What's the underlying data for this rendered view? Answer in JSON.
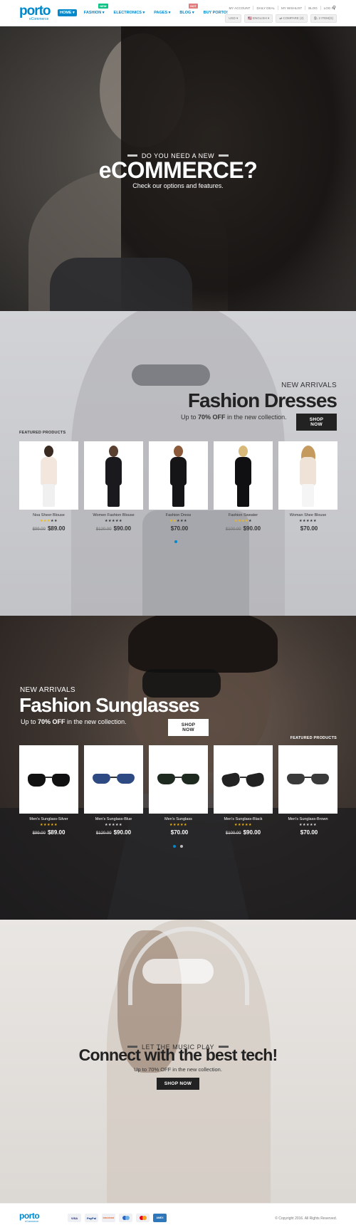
{
  "header": {
    "logo": "porto",
    "logo_sub": "eCommerce",
    "nav": [
      {
        "label": "HOME ▾",
        "active": true
      },
      {
        "label": "FASHION ▾",
        "badge": "NEW"
      },
      {
        "label": "ELECTRONICS ▾"
      },
      {
        "label": "PAGES ▾"
      },
      {
        "label": "BLOG ▾",
        "badge": "HOT"
      },
      {
        "label": "BUY PORTO!"
      }
    ],
    "top_links": [
      "MY ACCOUNT",
      "DAILY DEAL",
      "MY WISHLIST",
      "BLOG",
      "LOG IN"
    ],
    "currency": "USD ▾",
    "language": "🇺🇸 ENGLISH ▾",
    "compare": "⇄ COMPARE (2)",
    "cart": "🛍 2 ITEM(S)"
  },
  "hero1": {
    "kicker": "DO YOU NEED A NEW",
    "title": "eCOMMERCE?",
    "subtitle": "Check our options and features."
  },
  "dresses": {
    "kicker": "NEW ARRIVALS",
    "title": "Fashion Dresses",
    "promo_pre": "Up to ",
    "promo_bold": "70% OFF",
    "promo_post": " in the new collection.",
    "button": "SHOP NOW",
    "featured": "FEATURED PRODUCTS",
    "products": [
      {
        "name": "Noa Sheer Blouse",
        "old": "$99.00",
        "price": "$89.00",
        "rating": 3
      },
      {
        "name": "Women Fashion Blouse",
        "old": "$120.00",
        "price": "$90.00",
        "rating": 0
      },
      {
        "name": "Fashion Dress",
        "old": "",
        "price": "$70.00",
        "rating": 2
      },
      {
        "name": "Fashion Sweater",
        "old": "$100.00",
        "price": "$90.00",
        "rating": 4
      },
      {
        "name": "Woman Shee Blouse",
        "old": "",
        "price": "$70.00",
        "rating": 0
      }
    ]
  },
  "sunglasses": {
    "kicker": "NEW ARRIVALS",
    "title": "Fashion Sunglasses",
    "promo_pre": "Up to ",
    "promo_bold": "70% OFF",
    "promo_post": " in the new collection.",
    "button": "SHOP NOW",
    "featured": "FEATURED PRODUCTS",
    "products": [
      {
        "name": "Men's Sunglass-Silver",
        "old": "$99.00",
        "price": "$89.00",
        "rating": 5
      },
      {
        "name": "Men's Sunglass-Blue",
        "old": "$120.00",
        "price": "$90.00",
        "rating": 0
      },
      {
        "name": "Men's Sunglass",
        "old": "",
        "price": "$70.00",
        "rating": 5
      },
      {
        "name": "Men's Sunglass-Black",
        "old": "$100.00",
        "price": "$90.00",
        "rating": 5
      },
      {
        "name": "Men's Sunglass-Brown",
        "old": "",
        "price": "$70.00",
        "rating": 0
      }
    ]
  },
  "music": {
    "kicker": "LET THE MUSIC PLAY",
    "title": "Connect with the best tech!",
    "subtitle": "Up to 70% OFF in the new collection.",
    "button": "SHOP NOW"
  },
  "footer": {
    "logo": "porto",
    "logo_sub": "eCommerce",
    "payments": [
      "VISA",
      "PayPal",
      "DISCOVER",
      "",
      "",
      "AMEX"
    ],
    "copyright": "© Copyright 2016. All Rights Reserved."
  },
  "colors": {
    "accent": "#0088cc",
    "star": "#f5b70a",
    "star_off": "#333333"
  }
}
